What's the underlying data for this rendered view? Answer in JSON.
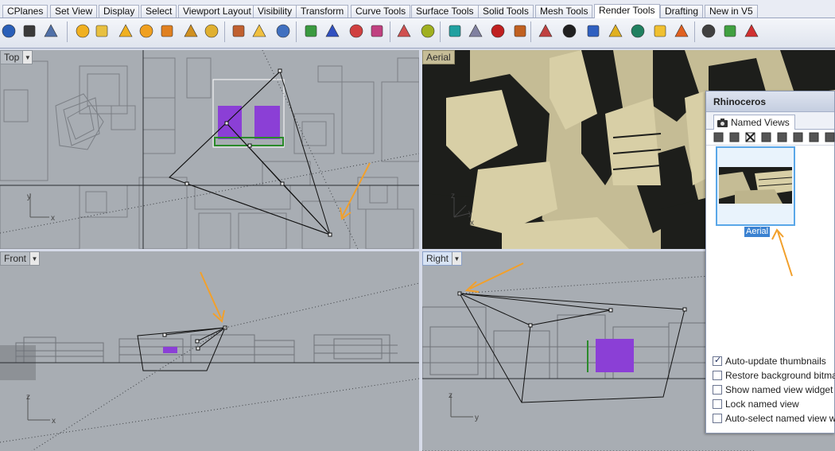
{
  "tabs": [
    {
      "label": "CPlanes",
      "active": false
    },
    {
      "label": "Set View",
      "active": false
    },
    {
      "label": "Display",
      "active": false
    },
    {
      "label": "Select",
      "active": false
    },
    {
      "label": "Viewport Layout",
      "active": false
    },
    {
      "label": "Visibility",
      "active": false
    },
    {
      "label": "Transform",
      "active": false
    },
    {
      "label": "Curve Tools",
      "active": false
    },
    {
      "label": "Surface Tools",
      "active": false
    },
    {
      "label": "Solid Tools",
      "active": false
    },
    {
      "label": "Mesh Tools",
      "active": false
    },
    {
      "label": "Render Tools",
      "active": true
    },
    {
      "label": "Drafting",
      "active": false
    },
    {
      "label": "New in V5",
      "active": false
    }
  ],
  "toolbar_icons": [
    "render-sphere-icon",
    "render-preview-icon",
    "render-window-icon",
    "spotlight-icon",
    "point-light-icon",
    "directional-light-icon",
    "rectangular-light-icon",
    "linear-light-icon",
    "light-edit-icon",
    "light-sun-icon",
    "flashlight-icon",
    "point-edit-icon",
    "move-point-icon",
    "material-editor-icon",
    "assign-material-icon",
    "texture-palette-icon",
    "decal-icon",
    "environment-icon",
    "texture-mapping-icon",
    "ground-plane-icon",
    "curved-plane-icon",
    "toolbox-icon",
    "ball-icon",
    "paint-brush-icon",
    "checker-icon",
    "ellipse-icon",
    "lightbulb-icon",
    "folder-grid-icon",
    "folder-icon",
    "sun-icon",
    "film-icon",
    "play-icon",
    "record-icon"
  ],
  "viewports": {
    "top": {
      "name": "Top"
    },
    "aerial": {
      "name": "Aerial"
    },
    "front": {
      "name": "Front"
    },
    "right": {
      "name": "Right"
    }
  },
  "axes": {
    "top": {
      "x": "x",
      "y": "y"
    },
    "aerial": {
      "x": "x",
      "y": "y",
      "z": "z"
    },
    "front": {
      "x": "x",
      "z": "z"
    },
    "right": {
      "y": "y",
      "z": "z"
    }
  },
  "panel": {
    "title": "Rhinoceros",
    "tab_label": "Named Views",
    "tools": [
      "save-view-icon",
      "edit-view-icon",
      "delete-view-icon",
      "import-view-icon",
      "restore-view-icon",
      "animate-view-icon",
      "show-view-icon",
      "thumbnail-options-icon"
    ],
    "thumbnail_caption": "Aerial",
    "options": [
      {
        "label": "Auto-update thumbnails",
        "checked": true
      },
      {
        "label": "Restore background bitmap",
        "checked": false
      },
      {
        "label": "Show named view widget",
        "checked": false
      },
      {
        "label": "Lock named view",
        "checked": false
      },
      {
        "label": "Auto-select named view widget",
        "checked": false
      }
    ]
  },
  "colors": {
    "accent": "#f2a02b",
    "selection": "#8b3fd6",
    "viewport_bg": "#a8adb3",
    "building_light": "#c5bc95",
    "building_shadow": "#1d1e1b"
  }
}
